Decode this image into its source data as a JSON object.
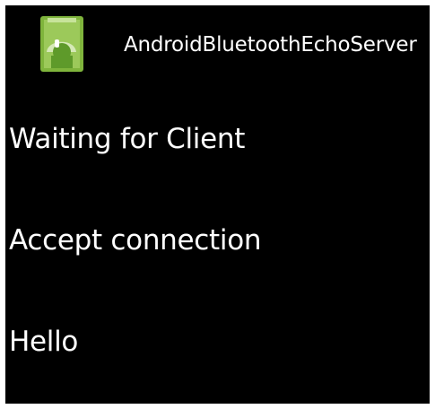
{
  "app": {
    "title": "AndroidBluetoothEchoServer",
    "icon": "android-app-icon"
  },
  "messages": [
    "Waiting for Client",
    "Accept connection",
    "Hello"
  ],
  "colors": {
    "background": "#000000",
    "text": "#ffffff",
    "icon_green": "#8ec63f"
  }
}
